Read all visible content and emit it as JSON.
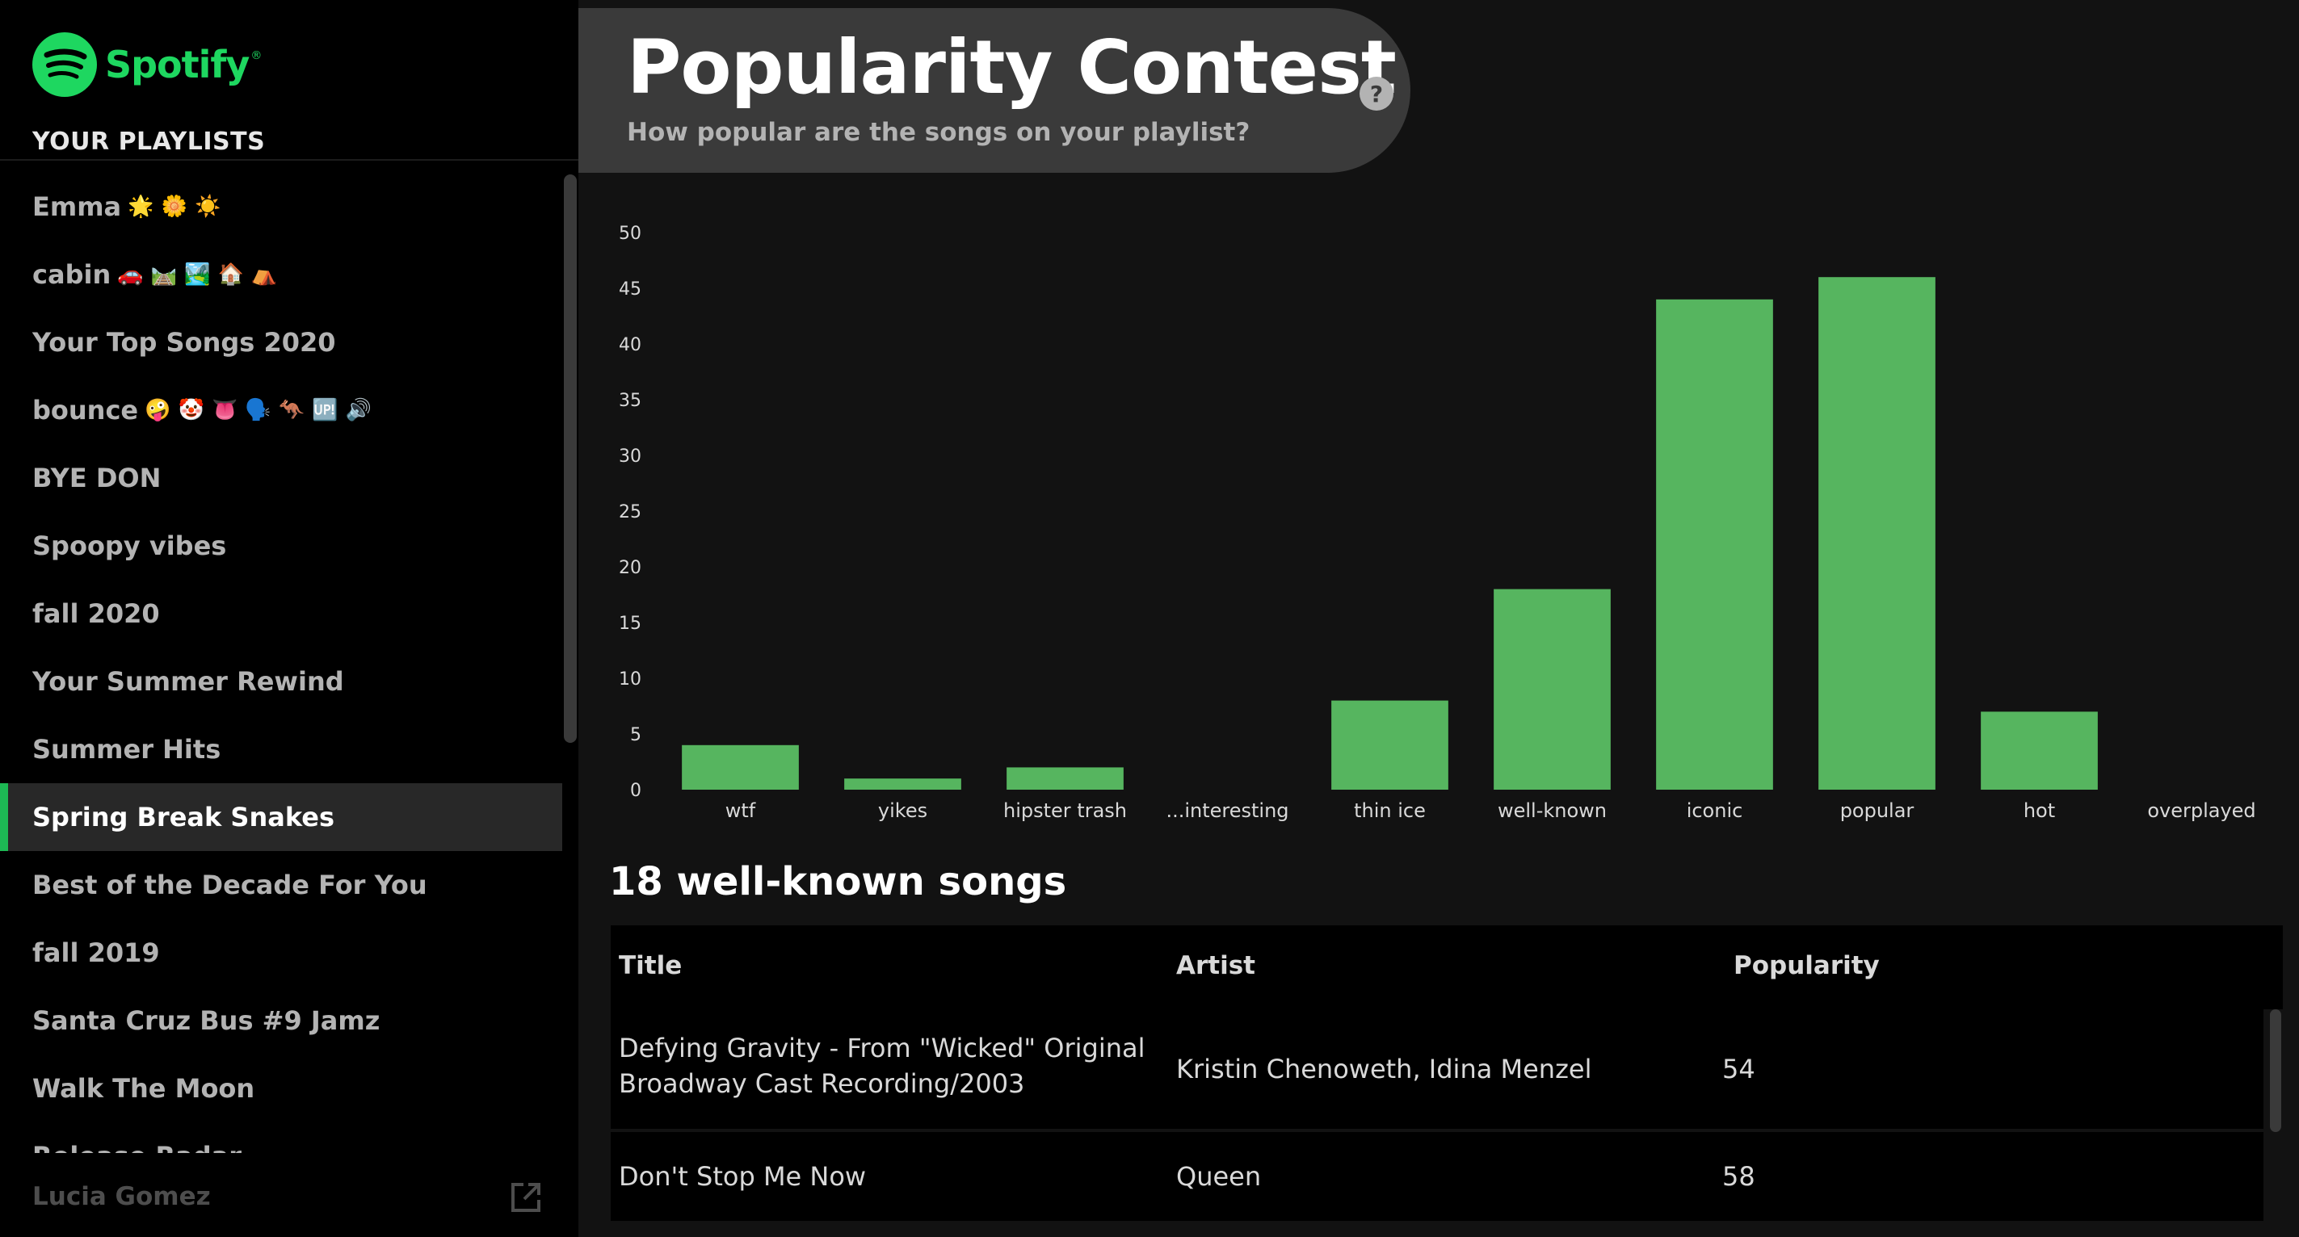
{
  "brand": {
    "name": "Spotify",
    "reg": "®",
    "color": "#1ed760"
  },
  "sidebar": {
    "heading": "YOUR PLAYLISTS",
    "items": [
      {
        "label": "Emma",
        "emoji": "🌟 🌼 ☀️"
      },
      {
        "label": "cabin",
        "emoji": "🚗 🛤️ 🏞️ 🏠 ⛺"
      },
      {
        "label": "Your Top Songs 2020",
        "emoji": ""
      },
      {
        "label": "bounce",
        "emoji": "🤪 🤡 👅 🗣️ 🦘 🆙 🔊"
      },
      {
        "label": "BYE DON",
        "emoji": ""
      },
      {
        "label": "Spoopy vibes",
        "emoji": ""
      },
      {
        "label": "fall 2020",
        "emoji": ""
      },
      {
        "label": "Your Summer Rewind",
        "emoji": ""
      },
      {
        "label": "Summer Hits",
        "emoji": ""
      },
      {
        "label": "Spring Break Snakes",
        "emoji": "",
        "active": true
      },
      {
        "label": "Best of the Decade For You",
        "emoji": ""
      },
      {
        "label": "fall 2019",
        "emoji": ""
      },
      {
        "label": "Santa Cruz Bus #9 Jamz",
        "emoji": ""
      },
      {
        "label": "Walk The Moon",
        "emoji": ""
      },
      {
        "label": "Release Radar",
        "emoji": ""
      }
    ],
    "user": "Lucia Gomez",
    "accent": "#1db954"
  },
  "header": {
    "title": "Popularity Contest",
    "subtitle": "How popular are the songs on your playlist?"
  },
  "chart_data": {
    "type": "bar",
    "categories": [
      "wtf",
      "yikes",
      "hipster trash",
      "...interesting",
      "thin ice",
      "well-known",
      "iconic",
      "popular",
      "hot",
      "overplayed"
    ],
    "values": [
      4,
      1,
      2,
      0,
      8,
      18,
      44,
      46,
      7,
      0
    ],
    "ylim": [
      0,
      50
    ],
    "yticks": [
      0,
      5,
      10,
      15,
      20,
      25,
      30,
      35,
      40,
      45,
      50
    ],
    "bar_color": "#56b55f",
    "grid": false
  },
  "songs": {
    "title": "18 well-known songs",
    "columns": [
      "Title",
      "Artist",
      "Popularity"
    ],
    "rows": [
      {
        "title_lines": [
          "Defying Gravity - From \"Wicked\" Original",
          "Broadway Cast Recording/2003"
        ],
        "artist": "Kristin Chenoweth, Idina Menzel",
        "popularity": "54"
      },
      {
        "title_lines": [
          "Don't Stop Me Now"
        ],
        "artist": "Queen",
        "popularity": "58"
      }
    ]
  }
}
